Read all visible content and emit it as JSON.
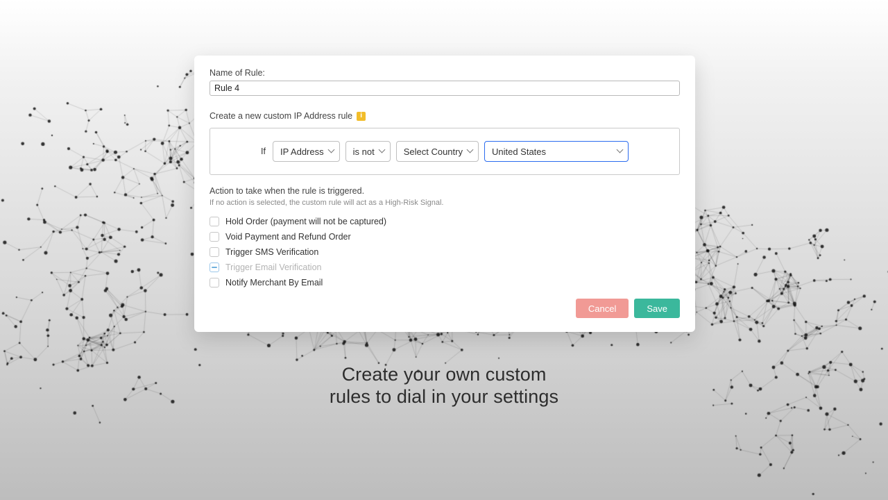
{
  "form": {
    "name_label": "Name of Rule:",
    "name_value": "Rule 4",
    "section_label": "Create a new custom IP Address rule",
    "if_label": "If",
    "field_select": "IP Address",
    "operator_select": "is not",
    "country_group_select": "Select Country",
    "country_select": "United States",
    "action_heading": "Action to take when the rule is triggered.",
    "action_sub": "If no action is selected, the custom rule will act as a High-Risk Signal.",
    "checks": {
      "hold": "Hold Order (payment will not be captured)",
      "void": "Void Payment and Refund Order",
      "sms": "Trigger SMS Verification",
      "email": "Trigger Email Verification",
      "notify": "Notify Merchant By Email"
    },
    "cancel": "Cancel",
    "save": "Save"
  },
  "tagline": {
    "line1": "Create your own custom",
    "line2": "rules to dial in your settings"
  },
  "colors": {
    "accent_save": "#3bb89c",
    "accent_cancel": "#f19a95",
    "focus_border": "#2b6cef",
    "info_badge": "#f2bd2a"
  }
}
